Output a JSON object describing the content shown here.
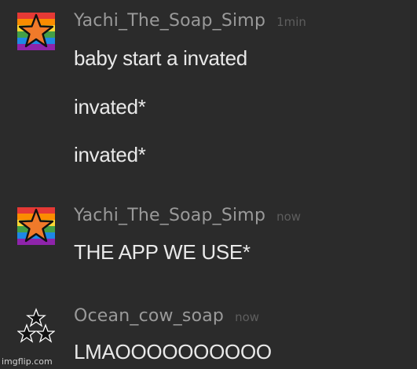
{
  "messages": [
    {
      "username": "Yachi_The_Soap_Simp",
      "timestamp": "1min",
      "avatar": "rainbow-star-avatar",
      "lines": [
        "baby start a invated",
        "invated*",
        "invated*"
      ]
    },
    {
      "username": "Yachi_The_Soap_Simp",
      "timestamp": "now",
      "avatar": "rainbow-star-avatar",
      "lines": [
        "THE APP WE USE*"
      ]
    },
    {
      "username": "Ocean_cow_soap",
      "timestamp": "now",
      "avatar": "black-stars-avatar",
      "lines": [
        "LMAOOOOOOOOOO"
      ]
    }
  ],
  "watermark": "imgflip.com",
  "colors": {
    "background": "#2b2b2b",
    "username": "#9a9a9a",
    "timestamp": "#5e5e5e",
    "text": "#e9e9e9",
    "star": "#f07a2a"
  }
}
